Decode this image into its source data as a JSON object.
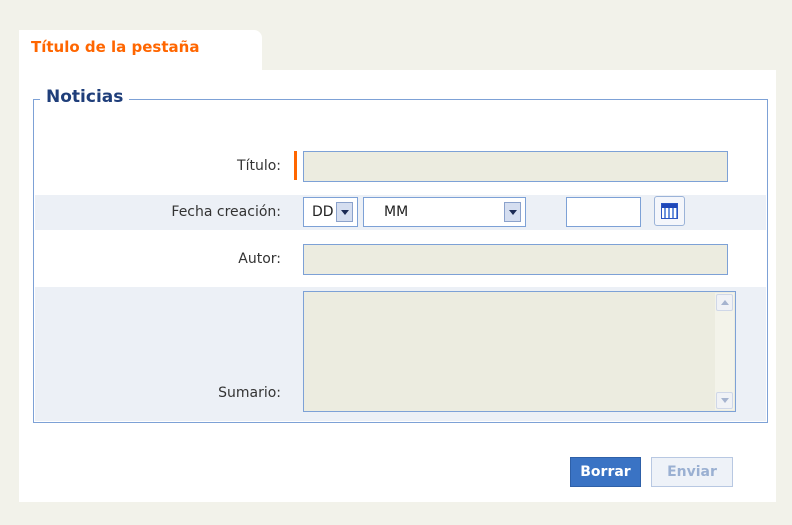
{
  "tab": {
    "title": "Título de la pestaña"
  },
  "form": {
    "legend": "Noticias",
    "titulo": {
      "label": "Título:",
      "value": ""
    },
    "fecha": {
      "label": "Fecha creación:",
      "day": "DD",
      "month": "MM",
      "year": ""
    },
    "autor": {
      "label": "Autor:",
      "value": ""
    },
    "sumario": {
      "label": "Sumario:",
      "value": ""
    }
  },
  "buttons": {
    "borrar": "Borrar",
    "enviar": "Enviar"
  },
  "colors": {
    "accent": "#ff6600",
    "border": "#7da1d6",
    "primary_button": "#3a73c4",
    "input_bg": "#ecece0"
  },
  "icons": {
    "calendar": "calendar-icon"
  }
}
